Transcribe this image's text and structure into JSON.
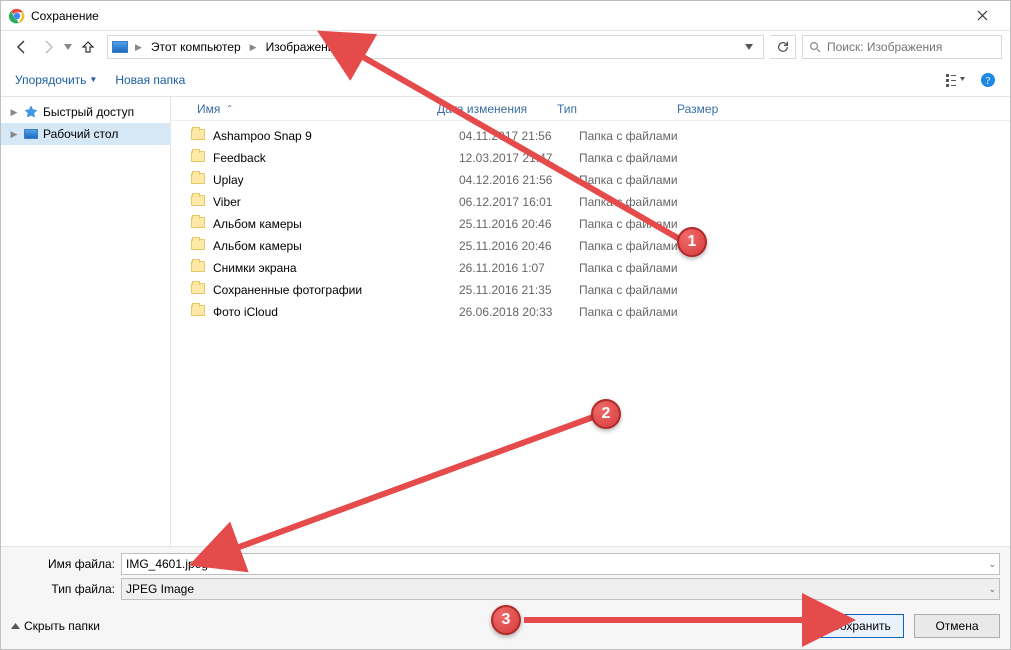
{
  "window": {
    "title": "Сохранение"
  },
  "breadcrumb": {
    "root": "Этот компьютер",
    "current": "Изображения"
  },
  "search": {
    "placeholder": "Поиск: Изображения"
  },
  "toolbar": {
    "organize": "Упорядочить",
    "new_folder": "Новая папка"
  },
  "columns": {
    "name": "Имя",
    "date": "Дата изменения",
    "type": "Тип",
    "size": "Размер"
  },
  "sidebar": {
    "quick_access": "Быстрый доступ",
    "desktop": "Рабочий стол"
  },
  "rows": [
    {
      "name": "Ashampoo Snap 9",
      "date": "04.11.2017 21:56",
      "type": "Папка с файлами"
    },
    {
      "name": "Feedback",
      "date": "12.03.2017 21:47",
      "type": "Папка с файлами"
    },
    {
      "name": "Uplay",
      "date": "04.12.2016 21:56",
      "type": "Папка с файлами"
    },
    {
      "name": "Viber",
      "date": "06.12.2017 16:01",
      "type": "Папка с файлами"
    },
    {
      "name": "Альбом камеры",
      "date": "25.11.2016 20:46",
      "type": "Папка с файлами"
    },
    {
      "name": "Альбом камеры",
      "date": "25.11.2016 20:46",
      "type": "Папка с файлами"
    },
    {
      "name": "Снимки экрана",
      "date": "26.11.2016 1:07",
      "type": "Папка с файлами"
    },
    {
      "name": "Сохраненные фотографии",
      "date": "25.11.2016 21:35",
      "type": "Папка с файлами"
    },
    {
      "name": "Фото iCloud",
      "date": "26.06.2018 20:33",
      "type": "Папка с файлами"
    }
  ],
  "form": {
    "filename_label": "Имя файла:",
    "filename_value": "IMG_4601.jpeg",
    "filetype_label": "Тип файла:",
    "filetype_value": "JPEG Image",
    "hide_folders": "Скрыть папки",
    "save": "Сохранить",
    "cancel": "Отмена"
  },
  "annotations": {
    "m1": "1",
    "m2": "2",
    "m3": "3"
  }
}
